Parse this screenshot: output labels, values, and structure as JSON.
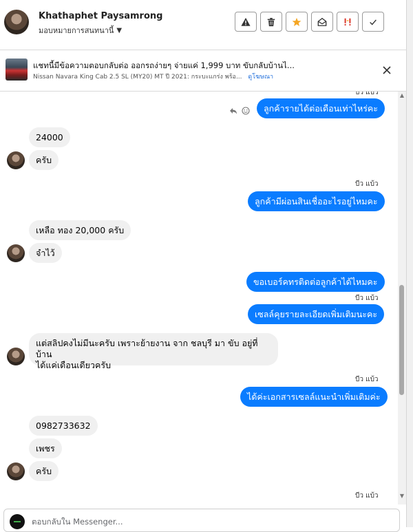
{
  "header": {
    "name": "Khathaphet Paysamrong",
    "assign_label": "มอบหมายการสนทนานี้",
    "toolbar": [
      "warning-icon",
      "trash-icon",
      "star-icon",
      "mark-unread-icon",
      "spam-icon",
      "done-check-icon"
    ]
  },
  "ad": {
    "title": "แชทนี้มีข้อความตอบกลับต่อ ออกรถง่ายๆ จ่ายแค่ 1,999 บาท ขับกลับบ้านไ...",
    "subtitle": "Nissan Navara King Cab 2.5 SL (MY20) MT ปี 2021: กระบะแกร่ง พร้อ...",
    "link": "ดูโฆษณา"
  },
  "messages": {
    "seen_top": "บีว แบ้ว",
    "out1": "ลูกค้ารายได้ต่อเดือนเท่าไหร่คะ",
    "in1": "24000",
    "in2": "ครับ",
    "seen2": "บีว แบ้ว",
    "out2": "ลูกค้ามีผ่อนสินเชื่ออะไรอยู่ไหมคะ",
    "in3": "เหลือ ทอง 20,000 ครับ",
    "in4": "จำไว้",
    "out3": "ขอเบอร์คทรติดต่อลูกค้าได้ไหมคะ",
    "seen3": "บีว แบ้ว",
    "out4": "เซลล์คุยรายละเอียดเพิ่มเติมนะคะ",
    "in5_line1": "แต่สลิปคงไม่มีนะครับ เพราะย้ายงาน จาก ชลบุรี มา ขับ อยู่ที่บ้าน",
    "in5_line2": "ได้แค่เดือนเดียวครับ",
    "seen4": "บีว แบ้ว",
    "out5": "ได้ค่ะเอกสารเซลล์แนะนำเพิ่มเติมค่ะ",
    "in6": "0982733632",
    "in7": "เพชร",
    "in8": "ครับ",
    "seen5": "บีว แบ้ว"
  },
  "composer": {
    "placeholder": "ตอบกลับใน Messenger..."
  },
  "colors": {
    "outgoing": "#0a7cff",
    "incoming": "#f0f0f0",
    "star": "#f5a623",
    "spam": "#d93025"
  }
}
